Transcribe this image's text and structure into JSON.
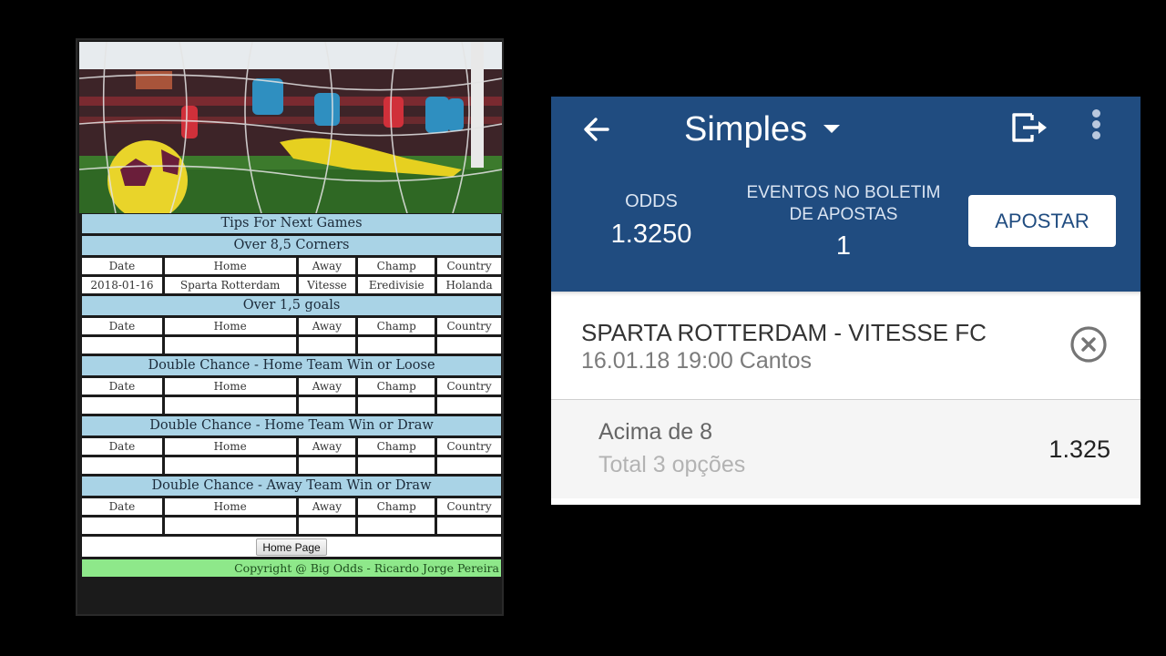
{
  "tips_page": {
    "hero_image_alt": "soccer-goal-photo",
    "title": "Tips For Next Games",
    "columns": [
      "Date",
      "Home",
      "Away",
      "Champ",
      "Country"
    ],
    "sections": [
      {
        "title": "Over 8,5 Corners",
        "rows": [
          [
            "2018-01-16",
            "Sparta Rotterdam",
            "Vitesse",
            "Eredivisie",
            "Holanda"
          ]
        ]
      },
      {
        "title": "Over 1,5 goals",
        "rows": [
          [
            "",
            "",
            "",
            "",
            ""
          ]
        ]
      },
      {
        "title": "Double Chance - Home Team Win or Loose",
        "rows": [
          [
            "",
            "",
            "",
            "",
            ""
          ]
        ]
      },
      {
        "title": "Double Chance - Home Team Win or Draw",
        "rows": [
          [
            "",
            "",
            "",
            "",
            ""
          ]
        ]
      },
      {
        "title": "Double Chance - Away Team Win or Draw",
        "rows": [
          [
            "",
            "",
            "",
            "",
            ""
          ]
        ]
      }
    ],
    "home_button_label": "Home Page",
    "copyright": "Copyright @ Big Odds - Ricardo Jorge Pereira",
    "colors": {
      "section_bg": "#a9d3e6",
      "footer_bg": "#8ee88a"
    }
  },
  "betslip": {
    "title": "Simples",
    "odds_label": "ODDS",
    "odds_value": "1.3250",
    "events_label_line1": "EVENTOS NO BOLETIM",
    "events_label_line2": "DE APOSTAS",
    "events_value": "1",
    "apostar_label": "APOSTAR",
    "event": {
      "name": "SPARTA ROTTERDAM - VITESSE FC",
      "details": "16.01.18 19:00 Cantos"
    },
    "selection": {
      "name": "Acima de 8",
      "sub": "Total 3 opções",
      "odds": "1.325"
    },
    "colors": {
      "header_bg": "#204c80",
      "button_text": "#204c80"
    }
  }
}
